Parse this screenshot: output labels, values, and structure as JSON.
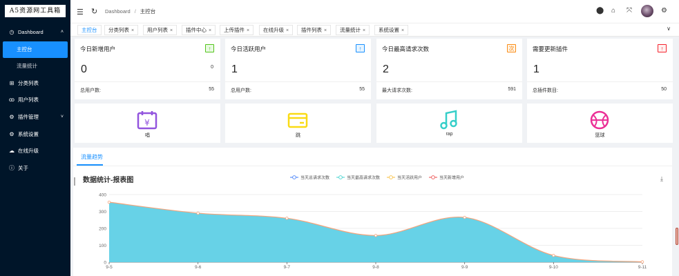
{
  "logo": {
    "text": "A5资源网工具箱"
  },
  "sidebar": {
    "items": [
      {
        "label": "Dashboard",
        "icon": "dashboard-icon",
        "glyph": "◷",
        "level": "top",
        "arrow": "︿"
      },
      {
        "label": "主控台",
        "level": "sub",
        "active": true
      },
      {
        "label": "流量统计",
        "level": "sub"
      },
      {
        "label": "分类列表",
        "icon": "gift-icon",
        "glyph": "⊞",
        "level": "top"
      },
      {
        "label": "用户列表",
        "icon": "users-icon",
        "glyph": "ꝏ",
        "level": "top"
      },
      {
        "label": "插件管理",
        "icon": "plugin-icon",
        "glyph": "⚙",
        "level": "top",
        "arrow": "﹀"
      },
      {
        "label": "系统设置",
        "icon": "settings-icon",
        "glyph": "⚙",
        "level": "top"
      },
      {
        "label": "在线升级",
        "icon": "cloud-icon",
        "glyph": "☁",
        "level": "top"
      },
      {
        "label": "关于",
        "icon": "info-icon",
        "glyph": "ⓘ",
        "level": "top"
      }
    ]
  },
  "header": {
    "breadcrumb": [
      "Dashboard",
      "主控台"
    ],
    "icons": [
      {
        "name": "github-icon",
        "glyph": "◉"
      },
      {
        "name": "lock-icon",
        "glyph": "🔒"
      },
      {
        "name": "fullscreen-icon",
        "glyph": "⤧"
      },
      {
        "name": "settings-icon",
        "glyph": "⚙"
      }
    ]
  },
  "tabs": [
    {
      "label": "主控台",
      "active": true,
      "closable": false
    },
    {
      "label": "分类列表",
      "closable": true
    },
    {
      "label": "用户列表",
      "closable": true
    },
    {
      "label": "插件中心",
      "closable": true
    },
    {
      "label": "上传插件",
      "closable": true
    },
    {
      "label": "在线升级",
      "closable": true
    },
    {
      "label": "插件列表",
      "closable": true
    },
    {
      "label": "流量统计",
      "closable": true
    },
    {
      "label": "系统设置",
      "closable": true
    }
  ],
  "stats": [
    {
      "title": "今日新增用户",
      "badge": "↑",
      "badge_color": "#52c41a",
      "badge_bg": "#e9f9e3",
      "value": "0",
      "small": "0",
      "foot_label": "总用户数:",
      "foot_value": "55"
    },
    {
      "title": "今日活跃用户",
      "badge": "↑",
      "badge_color": "#1890ff",
      "badge_bg": "#e6f4ff",
      "value": "1",
      "small": "",
      "foot_label": "总用户数:",
      "foot_value": "55"
    },
    {
      "title": "今日最高请求次数",
      "badge": "次",
      "badge_color": "#fa8c16",
      "badge_bg": "#fff4e6",
      "value": "2",
      "small": "",
      "foot_label": "最大请求次数:",
      "foot_value": "591"
    },
    {
      "title": "需要更新插件",
      "badge": "↑",
      "badge_color": "#f5222d",
      "badge_bg": "#fff1f0",
      "value": "1",
      "small": "",
      "foot_label": "总插件数目:",
      "foot_value": "50"
    }
  ],
  "quick_cards": [
    {
      "label": "唱",
      "icon": "calendar-yuan-icon",
      "color": "#9254de"
    },
    {
      "label": "跳",
      "icon": "wallet-icon",
      "color": "#fadb14"
    },
    {
      "label": "rap",
      "icon": "music-icon",
      "color": "#36cfc9"
    },
    {
      "label": "篮球",
      "icon": "basketball-icon",
      "color": "#eb2f96"
    }
  ],
  "chart_section": {
    "tab_label": "流量趋势",
    "title": "数据统计-报表图"
  },
  "chart_data": {
    "type": "area",
    "title": "数据统计-报表图",
    "legend_position": "top-center",
    "legend": [
      {
        "name": "当天总请求次数",
        "color": "#5b8ff9"
      },
      {
        "name": "当天最高请求次数",
        "color": "#5ad8d4"
      },
      {
        "name": "当天活跃用户",
        "color": "#fac858"
      },
      {
        "name": "当天新增用户",
        "color": "#ee6666"
      }
    ],
    "x": [
      "9-5",
      "9-6",
      "9-7",
      "9-8",
      "9-9",
      "9-10",
      "9-11"
    ],
    "y_ticks": [
      0,
      100,
      200,
      300,
      400
    ],
    "ylim": [
      0,
      400
    ],
    "grid": true,
    "series": [
      {
        "name": "当天总请求次数",
        "color": "#5b8ff9",
        "values": [
          355,
          290,
          260,
          158,
          265,
          40,
          2
        ]
      }
    ],
    "area_color": "#5fd0e6"
  }
}
